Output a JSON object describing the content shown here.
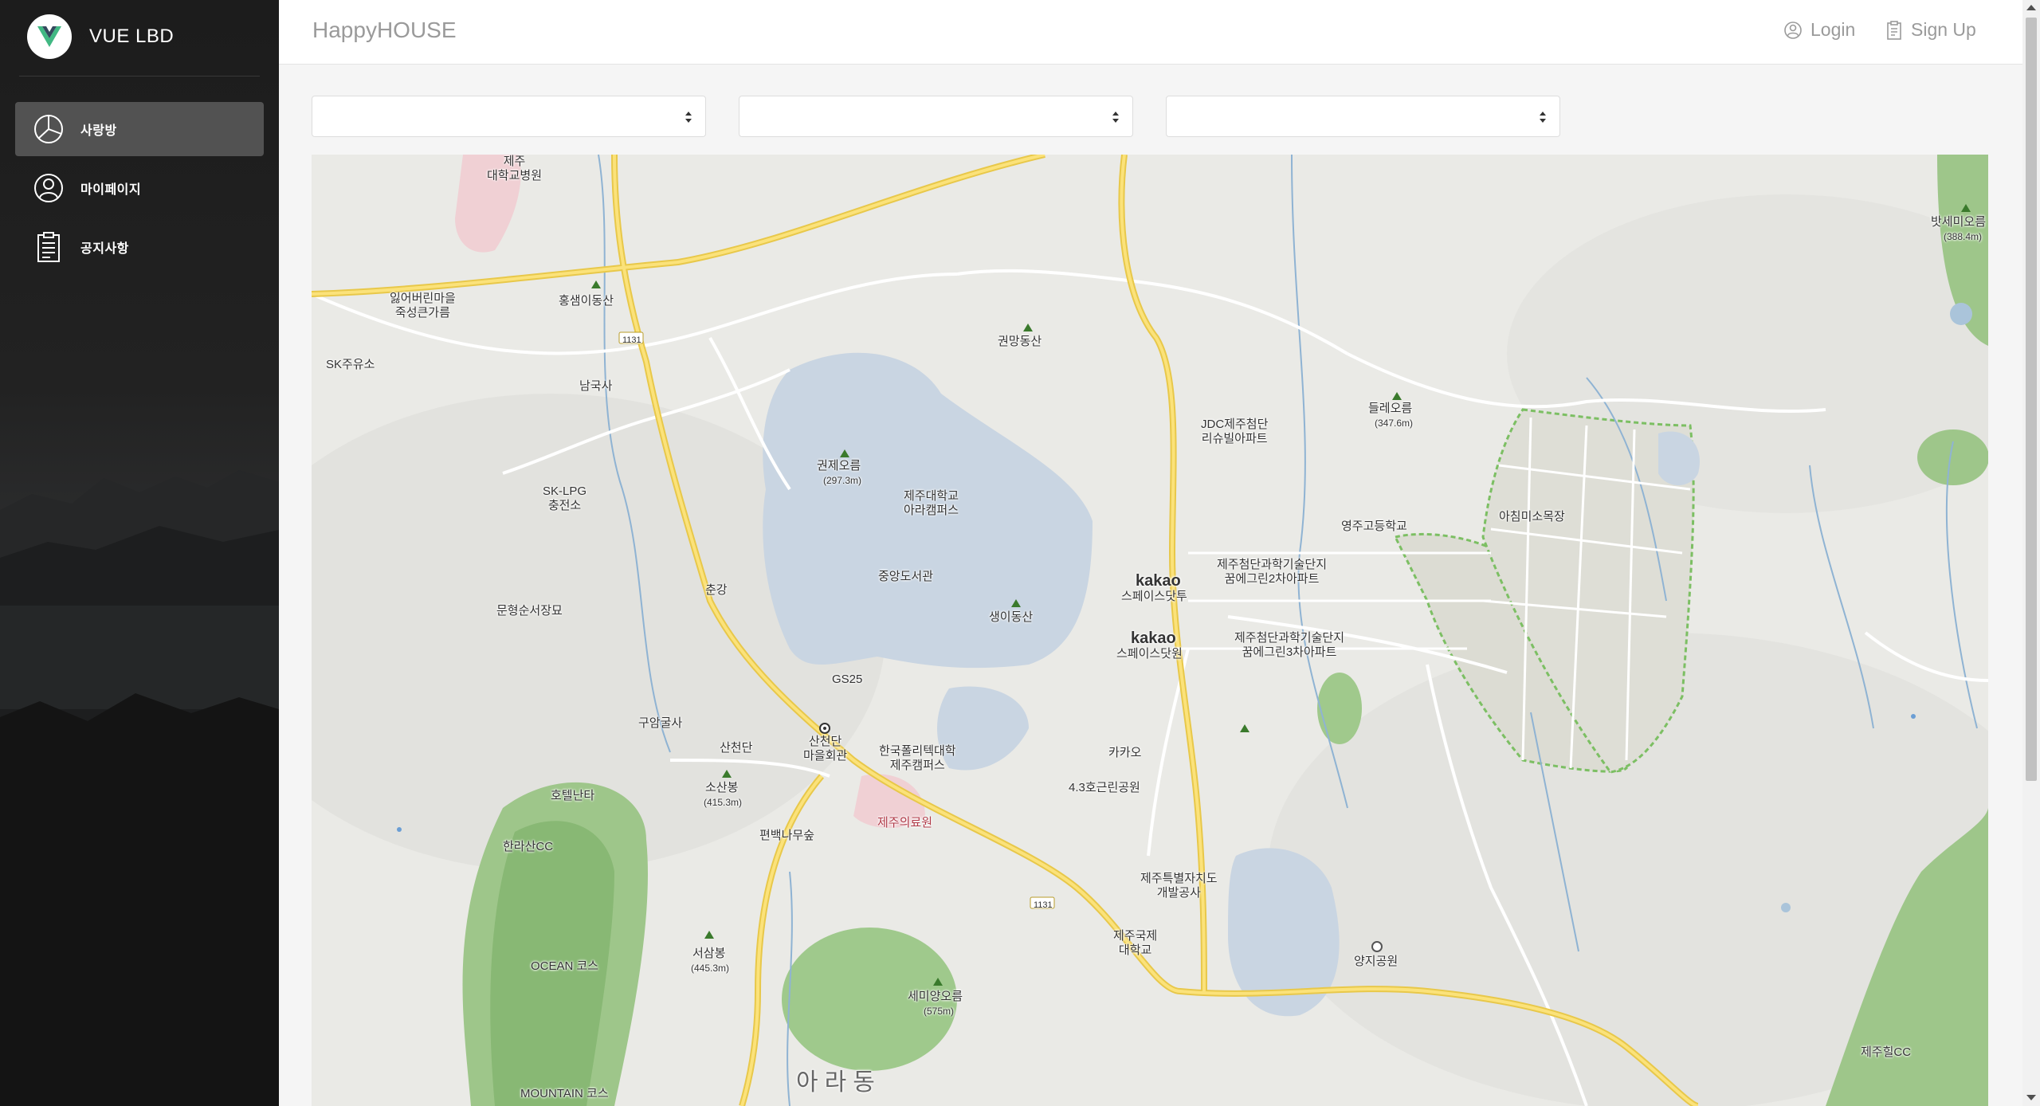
{
  "brand": {
    "name": "VUE LBD",
    "logo_icon": "vue-logo-icon"
  },
  "sidebar": {
    "items": [
      {
        "label": "사랑방",
        "icon": "pie-chart-icon",
        "active": true
      },
      {
        "label": "마이페이지",
        "icon": "user-icon",
        "active": false
      },
      {
        "label": "공지사항",
        "icon": "clipboard-icon",
        "active": false
      }
    ]
  },
  "header": {
    "title": "HappyHOUSE",
    "login_label": "Login",
    "signup_label": "Sign Up"
  },
  "filters": {
    "select1_value": "",
    "select2_value": "",
    "select3_value": ""
  },
  "map": {
    "labels": {
      "jeju_univ_hospital": "제주\n대학교병원",
      "ilgeobeorin": "잃어버린마을\n죽성큰가름",
      "hongsaengi": "홍샘이동산",
      "sk_oil": "SK주유소",
      "namguksa": "남국사",
      "sk_lpg": "SK-LPG\n충전소",
      "road_1131_top": "1131",
      "gwonmang": "권망동산",
      "gwonje_oreum": "권제오름",
      "gwonje_height": "(297.3m)",
      "jeju_univ_ara": "제주대학교\n아라캠퍼스",
      "central_library": "중앙도서관",
      "saengi_dongsan": "생이동산",
      "chungang": "춘강",
      "munhyeongsun": "문형순서장묘",
      "gs25": "GS25",
      "gugamsa": "구암굴사",
      "sancheondan": "산천단",
      "sancheondan_hall": "산천단\n마을회관",
      "polytech": "한국폴리텍대학\n제주캠퍼스",
      "hotel_nanta": "호텔난타",
      "sosanbong": "소산봉",
      "sosanbong_height": "(415.3m)",
      "jeju_medical": "제주의료원",
      "pyeonbaek": "편백나무숲",
      "hallasan_cc": "한라산CC",
      "ocean_course": "OCEAN 코스",
      "mountain_course": "MOUNTAIN 코스",
      "seosambong": "서삼봉",
      "seosambong_height": "(445.3m)",
      "semiyang": "세미양오름",
      "semiyang_height": "(575m)",
      "ara_dong": "아라동",
      "road_1131_bottom": "1131",
      "jdc_apt": "JDC제주첨단\n리슈빌아파트",
      "deulle_oreum": "들레오름",
      "deulle_height": "(347.6m)",
      "youngju_high": "영주고등학교",
      "achimmiso": "아침미소목장",
      "dream_green2": "제주첨단과학기술단지\n꿈에그린2차아파트",
      "dream_green3": "제주첨단과학기술단지\n꿈에그린3차아파트",
      "kakao_space_dot": "스페이스닷투",
      "kakao_space_one": "스페이스닷원",
      "kakao_word": "kakao",
      "kakao_poi": "카카오",
      "park_43": "4.3호근린공원",
      "jeju_dev_corp": "제주특별자치도\n개발공사",
      "jeju_intl_univ": "제주국제\n대학교",
      "yangji_park": "양지공원",
      "batsemi_oreum": "밧세미오름",
      "batsemi_height": "(388.4m)",
      "jeju_hill_cc": "제주힐CC"
    }
  },
  "colors": {
    "sidebar_bg": "#1e1e1e",
    "active_item_bg": "#5a5a5a",
    "map_bg": "#eaeae6",
    "road_yellow": "#f6dc5f",
    "campus_blue": "#c8d5e3",
    "park_green": "#93c47d"
  }
}
